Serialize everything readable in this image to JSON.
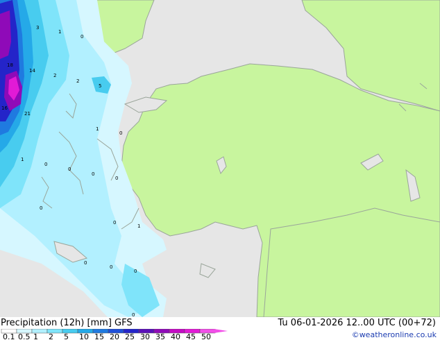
{
  "header": {
    "title": "Precipitation (12h) [mm] GFS",
    "valid_time": "Tu 06-01-2026 12..00 UTC (00+72)",
    "credit": "©weatheronline.co.uk"
  },
  "legend": {
    "ticks": [
      "0.1",
      "0.5",
      "1",
      "2",
      "5",
      "10",
      "15",
      "20",
      "25",
      "30",
      "35",
      "40",
      "45",
      "50"
    ],
    "colors": [
      "#ffffff",
      "#d6f7ff",
      "#b2f0ff",
      "#7fe4fa",
      "#48ccef",
      "#25a9e8",
      "#1f7ae0",
      "#1f4fd8",
      "#2424c9",
      "#5a10b8",
      "#8f0ab8",
      "#c40cc4",
      "#e21ad6",
      "#f24ee8"
    ]
  },
  "map": {
    "land_color": "#c8f59e",
    "sea_color": "#e6e6e6",
    "border_color": "#9aa59a",
    "values": [
      {
        "v": "3"
      },
      {
        "v": "1"
      },
      {
        "v": "0"
      },
      {
        "v": "18"
      },
      {
        "v": "14"
      },
      {
        "v": "2"
      },
      {
        "v": "2"
      },
      {
        "v": "5"
      },
      {
        "v": "16"
      },
      {
        "v": "21"
      },
      {
        "v": "1"
      },
      {
        "v": "0"
      },
      {
        "v": "1"
      },
      {
        "v": "0"
      },
      {
        "v": "0"
      },
      {
        "v": "0"
      },
      {
        "v": "0"
      },
      {
        "v": "0"
      },
      {
        "v": "0"
      },
      {
        "v": "1"
      },
      {
        "v": "0"
      },
      {
        "v": "0"
      },
      {
        "v": "0"
      },
      {
        "v": "0"
      }
    ]
  }
}
